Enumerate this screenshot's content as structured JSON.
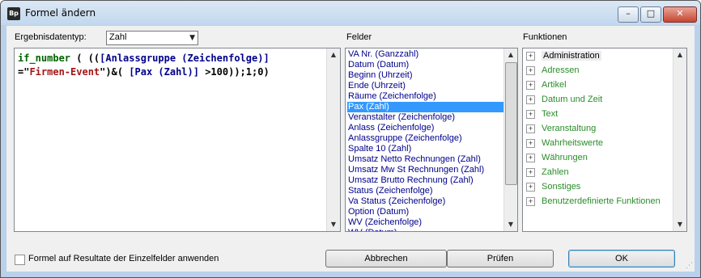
{
  "window": {
    "title": "Formel ändern",
    "icon_text": "Bp"
  },
  "ergebnis": {
    "label": "Ergebnisdatentyp:",
    "selected": "Zahl"
  },
  "editor": {
    "line1": {
      "kw": "if_number",
      "mid": " ( ((",
      "field": "[Anlassgruppe (Zeichenfolge)]"
    },
    "line2": {
      "pre": "=\"",
      "str": "Firmen-Event",
      "mid": "\")&( ",
      "field": "[Pax (Zahl)]",
      "post": " >100));1;0)"
    }
  },
  "felder": {
    "label": "Felder",
    "items": [
      "VA Nr. (Ganzzahl)",
      "Datum (Datum)",
      "Beginn (Uhrzeit)",
      "Ende (Uhrzeit)",
      "Räume (Zeichenfolge)",
      "Pax (Zahl)",
      "Veranstalter (Zeichenfolge)",
      "Anlass (Zeichenfolge)",
      "Anlassgruppe (Zeichenfolge)",
      "Spalte 10 (Zahl)",
      "Umsatz Netto Rechnungen (Zahl)",
      "Umsatz Mw St Rechnungen (Zahl)",
      "Umsatz Brutto Rechnung (Zahl)",
      "Status (Zeichenfolge)",
      "Va Status (Zeichenfolge)",
      "Option (Datum)",
      "WV (Zeichenfolge)",
      "WV (Datum)"
    ],
    "selected": "Pax (Zahl)"
  },
  "funktionen": {
    "label": "Funktionen",
    "items": [
      "Administration",
      "Adressen",
      "Artikel",
      "Datum und Zeit",
      "Text",
      "Veranstaltung",
      "Wahrheitswerte",
      "Währungen",
      "Zahlen",
      "Sonstiges",
      "Benutzerdefinierte Funktionen"
    ],
    "selected": "Administration",
    "expander": "+"
  },
  "footer": {
    "checkbox_label": "Formel auf Resultate der Einzelfelder anwenden",
    "checkbox_checked": false,
    "buttons": {
      "cancel": "Abbrechen",
      "check": "Prüfen",
      "ok": "OK"
    }
  },
  "colors": {
    "field": "#00008b",
    "keyword": "#006400",
    "string": "#a31515",
    "tree_text": "#2a8d2a",
    "selection": "#3399ff"
  }
}
